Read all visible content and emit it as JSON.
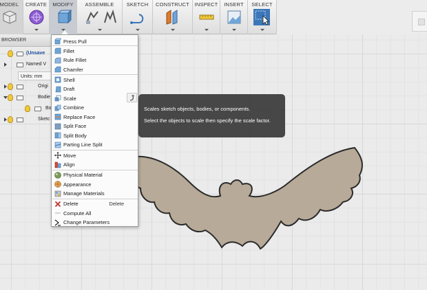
{
  "toolbar": {
    "tabs": [
      "MODEL",
      "CREATE",
      "MODIFY",
      "ASSEMBLE",
      "SKETCH",
      "CONSTRUCT",
      "INSPECT",
      "INSERT",
      "SELECT"
    ]
  },
  "browser": {
    "header": "BROWSER",
    "rows": [
      "(Unsave",
      "Named V",
      "Units: mm",
      "Origi",
      "Bodie",
      "Bo",
      "Sketc"
    ]
  },
  "menu": {
    "items": [
      {
        "label": "Press Pull",
        "shortcut": ""
      },
      {
        "label": "Fillet",
        "shortcut": ""
      },
      {
        "label": "Rule Fillet",
        "shortcut": ""
      },
      {
        "label": "Chamfer",
        "shortcut": ""
      },
      {
        "label": "Shell",
        "shortcut": ""
      },
      {
        "label": "Draft",
        "shortcut": ""
      },
      {
        "label": "Scale",
        "shortcut": ""
      },
      {
        "label": "Combine",
        "shortcut": ""
      },
      {
        "label": "Replace Face",
        "shortcut": ""
      },
      {
        "label": "Split Face",
        "shortcut": ""
      },
      {
        "label": "Split Body",
        "shortcut": ""
      },
      {
        "label": "Parting Line Split",
        "shortcut": ""
      },
      {
        "label": "Move",
        "shortcut": ""
      },
      {
        "label": "Align",
        "shortcut": ""
      },
      {
        "label": "Physical Material",
        "shortcut": ""
      },
      {
        "label": "Appearance",
        "shortcut": ""
      },
      {
        "label": "Manage Materials",
        "shortcut": ""
      },
      {
        "label": "Delete",
        "shortcut": "Delete"
      },
      {
        "label": "Compute All",
        "shortcut": ""
      },
      {
        "label": "Change Parameters",
        "shortcut": ""
      }
    ]
  },
  "tooltip": {
    "line1": "Scales sketch objects, bodies, or components.",
    "line2": "Select the objects to scale then specify the scale factor."
  },
  "colors": {
    "bat_fill": "#b7aa98",
    "tooltip_bg": "#3a3a3a",
    "select_accent": "#3b76b8"
  }
}
